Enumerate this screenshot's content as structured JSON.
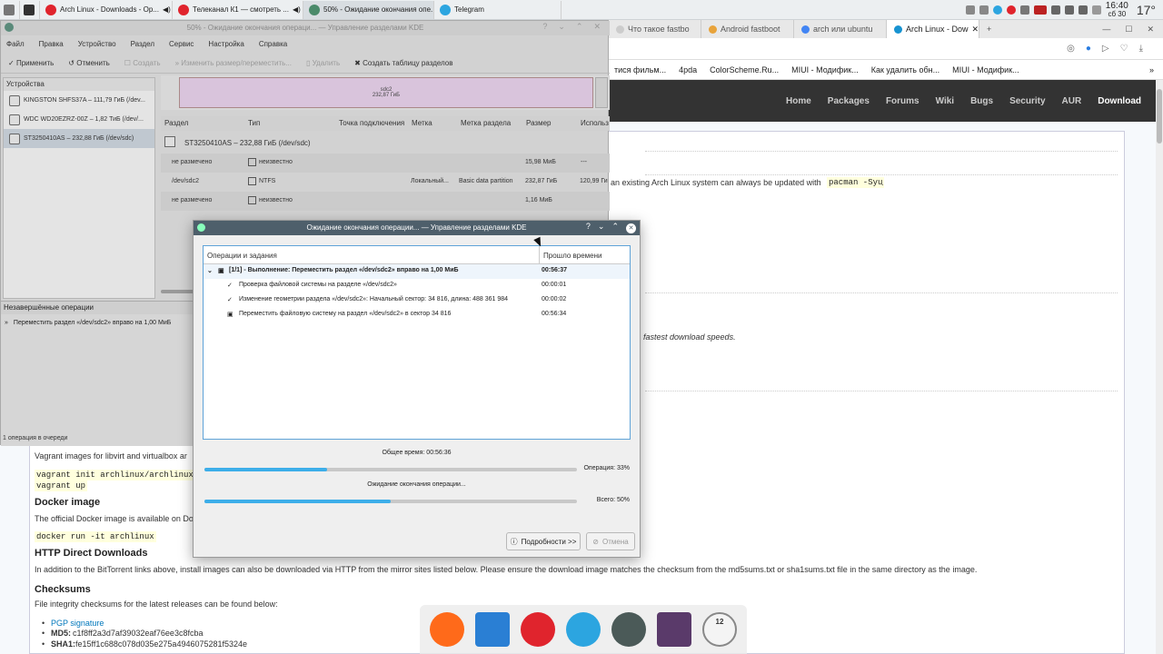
{
  "taskbar": {
    "tasks": [
      {
        "label": "Arch Linux - Downloads - Op...",
        "icon": "opera-icon"
      },
      {
        "label": "Телеканал К1 — смотреть ...",
        "icon": "opera-icon"
      },
      {
        "label": "50% - Ожидание окончания опе...",
        "icon": "partition-manager-icon"
      },
      {
        "label": "Telegram",
        "icon": "telegram-icon"
      }
    ],
    "time": "16:40",
    "date": "сб 30",
    "temperature": "17°"
  },
  "browser": {
    "tabs": [
      "Что такое fastbo",
      "Android fastboot",
      "arch или ubuntu",
      "Arch Linux - Dow"
    ],
    "bookmarks": [
      "тися фильм...",
      "4pda",
      "ColorScheme.Ru...",
      "MIUI - Модифик...",
      "Как удалить обн...",
      "MIUI - Модифик..."
    ],
    "nav": [
      "Home",
      "Packages",
      "Forums",
      "Wiki",
      "Bugs",
      "Security",
      "AUR",
      "Download"
    ],
    "line1_text": "an existing Arch Linux system can always be updated with",
    "line1_code": "pacman -Syu",
    "fastest": "fastest download speeds.",
    "vagrant_text": "Vagrant images for libvirt and virtualbox ar",
    "vagrant_code1": "vagrant init archlinux/archlinux",
    "vagrant_code2": "vagrant up",
    "docker_h": "Docker image",
    "docker_text": "The official Docker image is available on Do",
    "docker_code": "docker run -it archlinux",
    "http_h": "HTTP Direct Downloads",
    "http_text": "In addition to the BitTorrent links above, install images can also be downloaded via HTTP from the mirror sites listed below. Please ensure the download image matches the checksum from the md5sums.txt or sha1sums.txt file in the same directory as the image.",
    "checksums_h": "Checksums",
    "checksums_text": "File integrity checksums for the latest releases can be found below:",
    "pgp": "PGP signature",
    "md5_label": "MD5:",
    "md5": "c1f8ff2a3d7af39032eaf76ee3c8fcba",
    "sha1_label": "SHA1:",
    "sha1": "fe15ff1c688c078d035e275a4946075281f5324e"
  },
  "pm": {
    "title": "50% - Ожидание окончания операци... — Управление разделами KDE",
    "menu": [
      "Файл",
      "Правка",
      "Устройство",
      "Раздел",
      "Сервис",
      "Настройка",
      "Справка"
    ],
    "toolbar": [
      "Применить",
      "Отменить",
      "Создать",
      "Изменить размер/переместить...",
      "Удалить",
      "Создать таблицу разделов"
    ],
    "devices_title": "Устройства",
    "devices": [
      "KINGSTON SHFS37A – 111,79 ГиБ (/dev...",
      "WDC WD20EZRZ-00Z – 1,82 ТиБ (/dev/...",
      "ST3250410AS – 232,88 ГиБ (/dev/sdc)"
    ],
    "bar_label": "sdc2",
    "bar_size": "232,87 ГиБ",
    "columns": [
      "Раздел",
      "Тип",
      "Точка подключения",
      "Метка",
      "Метка раздела",
      "Размер",
      "Использ"
    ],
    "disk": "ST3250410AS – 232,88 ГиБ (/dev/sdc)",
    "rows": [
      {
        "part": "не размечено",
        "type": "неизвестно",
        "mount": "",
        "label": "",
        "plabel": "",
        "size": "15,98 МиБ",
        "used": "---"
      },
      {
        "part": "/dev/sdc2",
        "type": "NTFS",
        "mount": "",
        "label": "Локальный...",
        "plabel": "Basic data partition",
        "size": "232,87 ГиБ",
        "used": "120,99 Ги"
      },
      {
        "part": "не размечено",
        "type": "неизвестно",
        "mount": "",
        "label": "",
        "plabel": "",
        "size": "1,16 МиБ",
        "used": "---"
      }
    ],
    "pending_title": "Незавершённые операции",
    "pending_item": "Переместить раздел «/dev/sdc2» вправо на 1,00 МиБ",
    "status": "1 операция в очереди"
  },
  "dialog": {
    "title": "Ожидание окончания операции... — Управление разделами KDE",
    "col_ops": "Операции и задания",
    "col_time": "Прошло времени",
    "items": [
      {
        "text": "[1/1] - Выполнение: Переместить раздел «/dev/sdc2» вправо на 1,00 МиБ",
        "time": "00:56:37"
      },
      {
        "text": "Проверка файловой системы на разделе «/dev/sdc2»",
        "time": "00:00:01"
      },
      {
        "text": "Изменение геометрии раздела «/dev/sdc2»: Начальный сектор: 34 816, длина: 488 361 984",
        "time": "00:00:02"
      },
      {
        "text": "Переместить файловую систему на раздел «/dev/sdc2» в сектор 34 816",
        "time": "00:56:34"
      }
    ],
    "total_time": "Общее время: 00:56:36",
    "op_label": "Операция: 33%",
    "op_progress": 0.33,
    "waiting": "Ожидание окончания операции...",
    "all_label": "Всего: 50%",
    "all_progress": 0.5,
    "details_btn": "Подробности >>",
    "cancel_btn": "Отмена"
  },
  "dock": {
    "items": [
      "firefox-icon",
      "file-manager-icon",
      "opera-icon",
      "telegram-icon",
      "partition-manager-icon",
      "screenshot-icon",
      "clock-icon"
    ],
    "clock_mark": "12"
  }
}
